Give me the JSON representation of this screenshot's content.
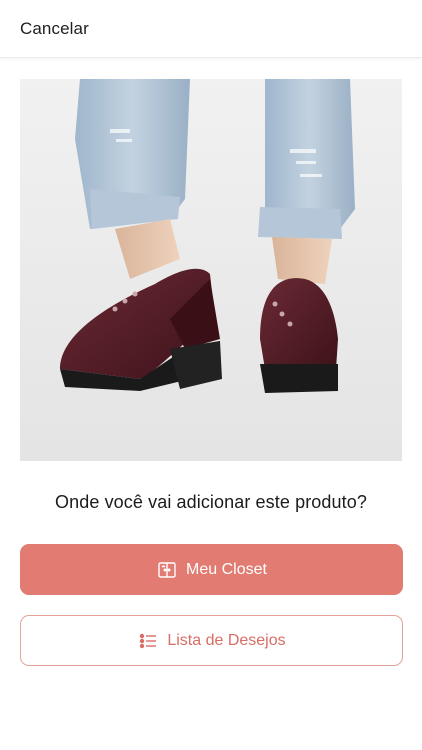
{
  "header": {
    "cancel_label": "Cancelar"
  },
  "product": {
    "image_alt": "Sapato oxford vinho com salto tratorado"
  },
  "prompt": {
    "question": "Onde você vai adicionar este produto?"
  },
  "actions": {
    "closet_label": "Meu Closet",
    "closet_icon": "closet-icon",
    "wishlist_label": "Lista de Desejos",
    "wishlist_icon": "list-icon"
  },
  "colors": {
    "accent": "#e27b72",
    "accent_text": "#d86d66",
    "secondary_border": "#e3a29c"
  }
}
